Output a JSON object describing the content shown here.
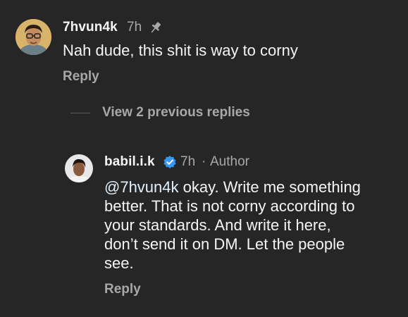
{
  "comment": {
    "username": "7hvun4k",
    "time": "7h",
    "text": "Nah dude, this shit is way to corny",
    "reply_label": "Reply",
    "pin_icon": "pin-icon"
  },
  "view_replies": {
    "label": "View 2 previous replies"
  },
  "reply": {
    "username": "babil.i.k",
    "verified_icon": "verified-badge-icon",
    "time": "7h",
    "separator": "·",
    "role": "Author",
    "mention": "@7hvun4k",
    "lines": [
      " okay. Write me something",
      "better. That is not corny according to",
      "your standards. And write it here,",
      "don’t send it on DM. Let the people",
      "see."
    ],
    "reply_label": "Reply"
  },
  "colors": {
    "background": "#262626",
    "text": "#f5f5f5",
    "secondary": "#a8a8a8",
    "verified": "#3897f0"
  }
}
